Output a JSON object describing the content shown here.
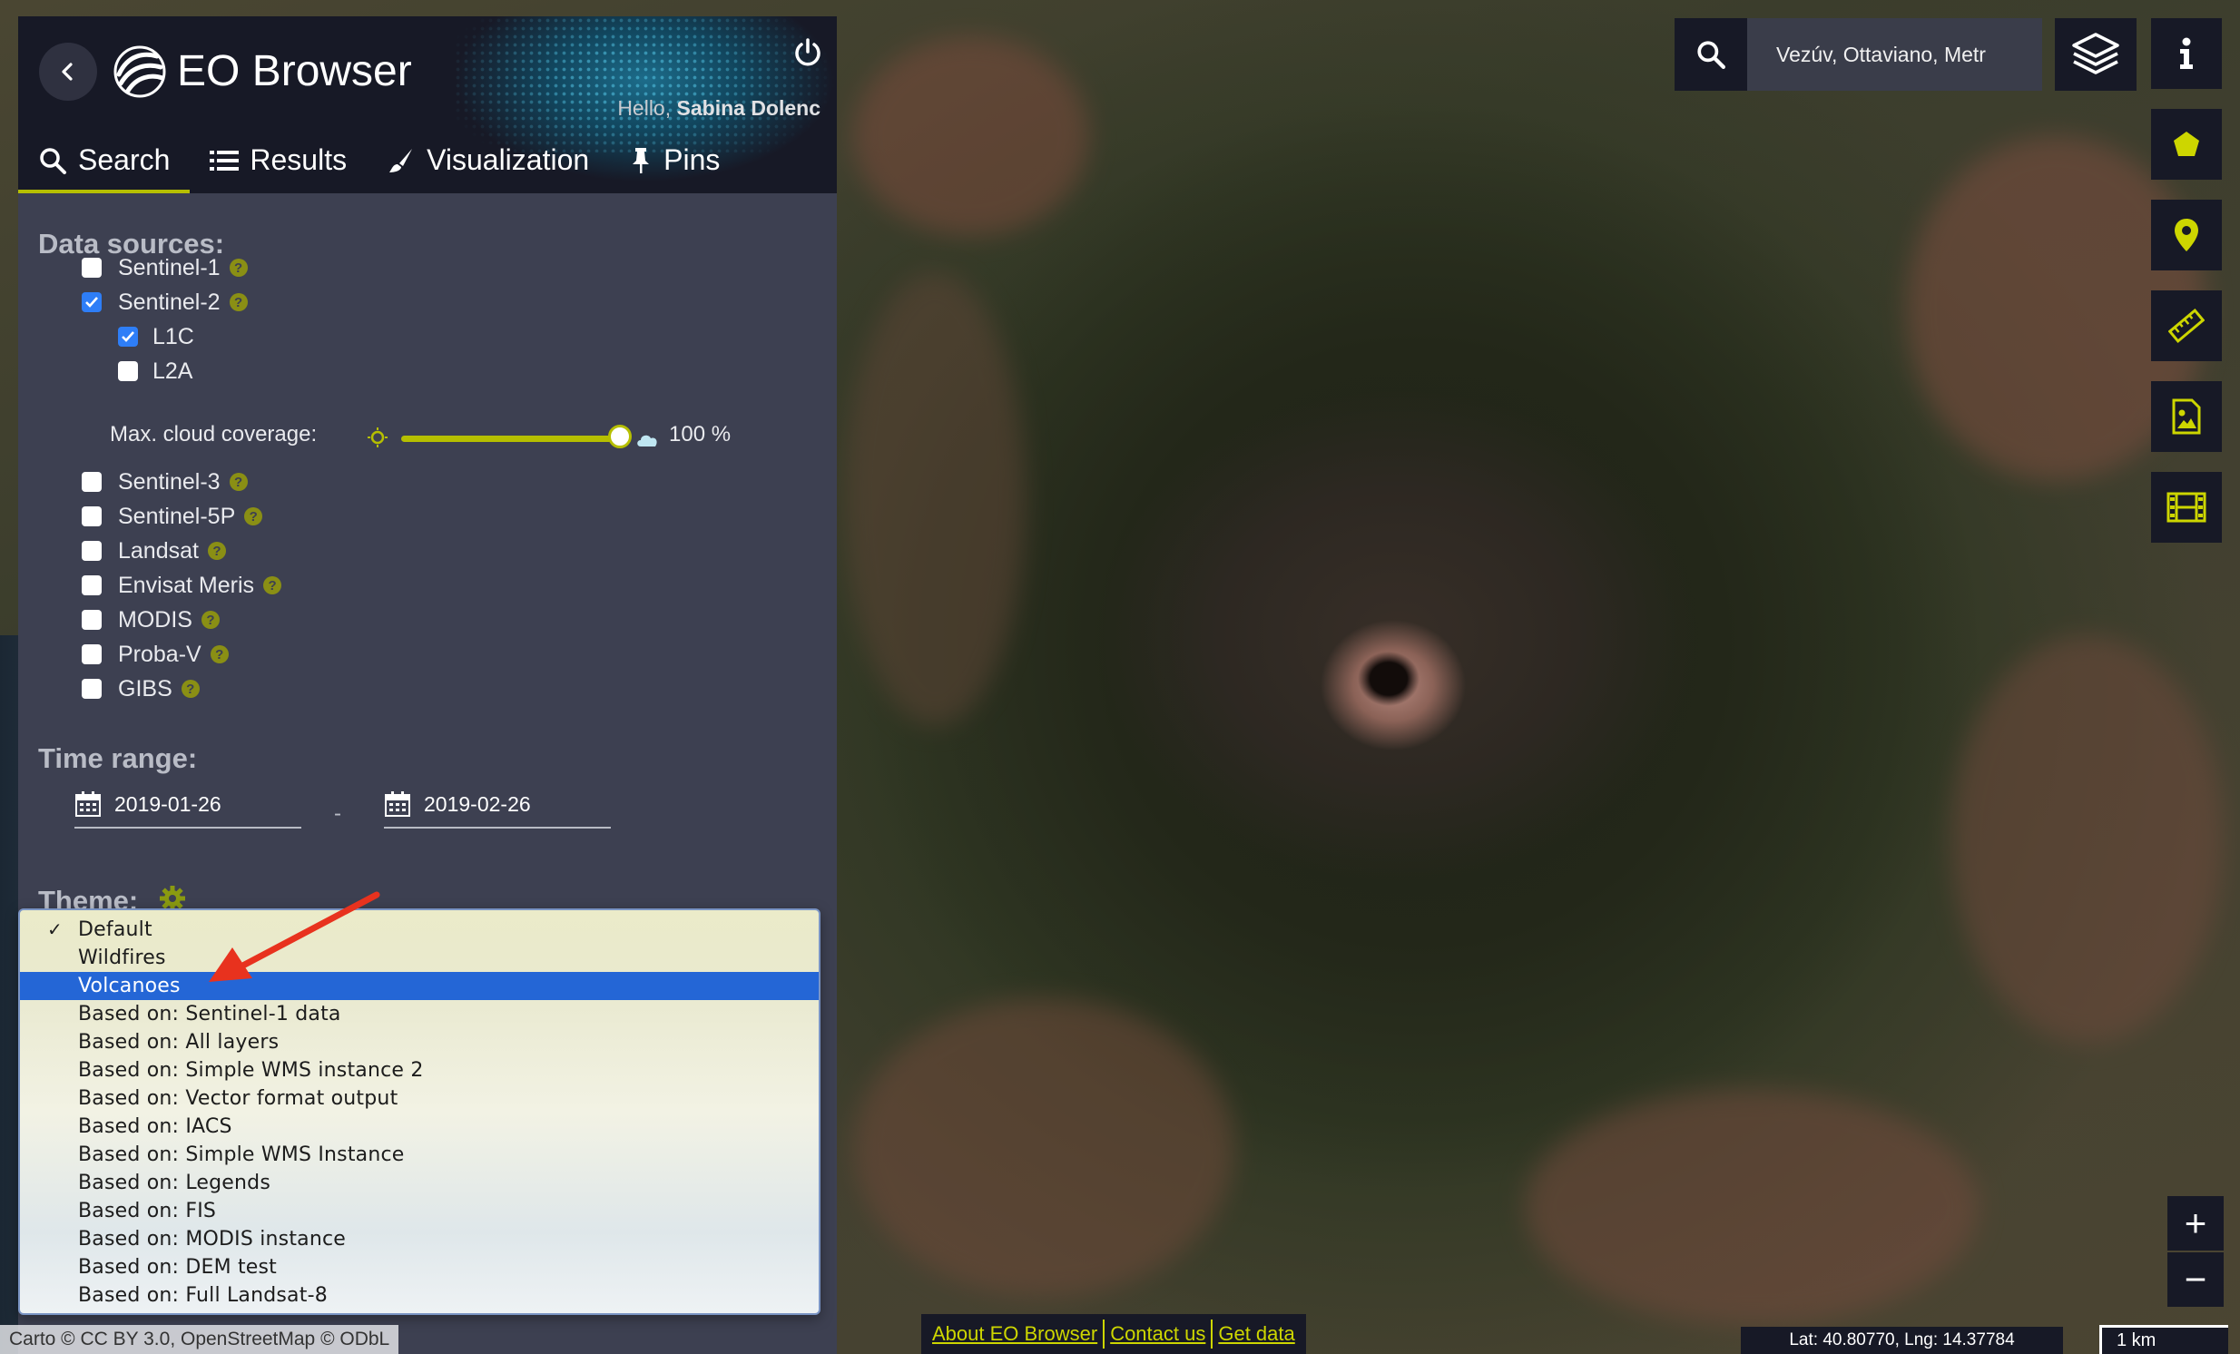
{
  "app": {
    "title": "EO Browser",
    "greeting_prefix": "Hello,",
    "user_name": "Sabina Dolenc",
    "accent_color": "#b6bf00",
    "panel_color": "#3d4051",
    "header_color": "#171926"
  },
  "tabs": [
    {
      "label": "Search",
      "icon": "search-icon",
      "active": true
    },
    {
      "label": "Results",
      "icon": "list-icon",
      "active": false
    },
    {
      "label": "Visualization",
      "icon": "brush-icon",
      "active": false
    },
    {
      "label": "Pins",
      "icon": "pin-icon",
      "active": false
    }
  ],
  "data_sources": {
    "title": "Data sources:",
    "items": [
      {
        "label": "Sentinel-1",
        "checked": false
      },
      {
        "label": "Sentinel-2",
        "checked": true
      },
      {
        "label": "L1C",
        "checked": true
      },
      {
        "label": "L2A",
        "checked": false
      },
      {
        "label": "Sentinel-3",
        "checked": false
      },
      {
        "label": "Sentinel-5P",
        "checked": false
      },
      {
        "label": "Landsat",
        "checked": false
      },
      {
        "label": "Envisat Meris",
        "checked": false
      },
      {
        "label": "MODIS",
        "checked": false
      },
      {
        "label": "Proba-V",
        "checked": false
      },
      {
        "label": "GIBS",
        "checked": false
      }
    ],
    "cloud_coverage_label": "Max. cloud coverage:",
    "cloud_coverage_value": "100 %",
    "cloud_coverage_fraction": 1.0
  },
  "time_range": {
    "title": "Time range:",
    "from": "2019-01-26",
    "separator": "-",
    "to": "2019-02-26"
  },
  "theme": {
    "title": "Theme:",
    "selected": "Default",
    "highlighted": "Volcanoes",
    "options": [
      "Default",
      "Wildfires",
      "Volcanoes",
      "Based on: Sentinel-1 data",
      "Based on: All layers",
      "Based on: Simple WMS instance 2",
      "Based on: Vector format output",
      "Based on: IACS",
      "Based on: Simple WMS Instance",
      "Based on: Legends",
      "Based on: FIS",
      "Based on: MODIS instance",
      "Based on: DEM test",
      "Based on: Full Landsat-8"
    ]
  },
  "map_controls": {
    "location_value": "Vezúv, Ottaviano, Metr",
    "tools": [
      "polygon-icon",
      "location-pin-icon",
      "ruler-icon",
      "image-download-icon",
      "film-icon"
    ],
    "zoom_in": "+",
    "zoom_out": "−"
  },
  "footer": {
    "attribution": "Carto © CC BY 3.0, OpenStreetMap © ODbL",
    "links": [
      "About EO Browser",
      "Contact us",
      "Get data"
    ],
    "coordinates": "Lat: 40.80770, Lng: 14.37784",
    "scale": "1 km"
  }
}
